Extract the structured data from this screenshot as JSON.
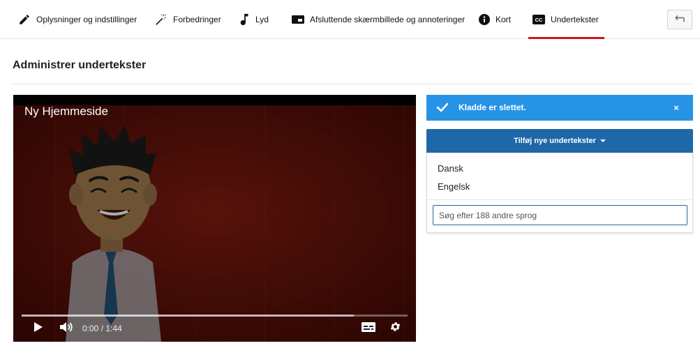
{
  "tabs": [
    {
      "id": "info",
      "label": "Oplysninger og indstillinger",
      "icon": "pencil-icon"
    },
    {
      "id": "enhance",
      "label": "Forbedringer",
      "icon": "magic-wand-icon"
    },
    {
      "id": "audio",
      "label": "Lyd",
      "icon": "music-note-icon"
    },
    {
      "id": "endscreen",
      "label": "Afsluttende skærmbillede og annoteringer",
      "icon": "end-screen-icon"
    },
    {
      "id": "cards",
      "label": "Kort",
      "icon": "info-icon"
    },
    {
      "id": "subtitles",
      "label": "Undertekster",
      "icon": "cc-icon",
      "badge": "CC",
      "active": true
    }
  ],
  "back_icon": "back-arrow-icon",
  "page": {
    "title": "Administrer undertekster"
  },
  "player": {
    "video_title": "Ny Hjemmeside",
    "time_display": "0:00 / 1:44",
    "progress_played": 0.0,
    "progress_buffered": 0.86,
    "icons": [
      "play-icon",
      "volume-icon",
      "subtitles-icon",
      "settings-gear-icon"
    ]
  },
  "alert": {
    "message": "Kladde er slettet.",
    "close_symbol": "×",
    "color": "#2793e6"
  },
  "add_subtitles": {
    "button_label": "Tilføj nye undertekster",
    "color": "#1e67a8",
    "languages": [
      "Dansk",
      "Engelsk"
    ],
    "search_placeholder": "Søg efter 188 andre sprog",
    "search_value": ""
  },
  "colors": {
    "accent_red": "#cc181e"
  }
}
